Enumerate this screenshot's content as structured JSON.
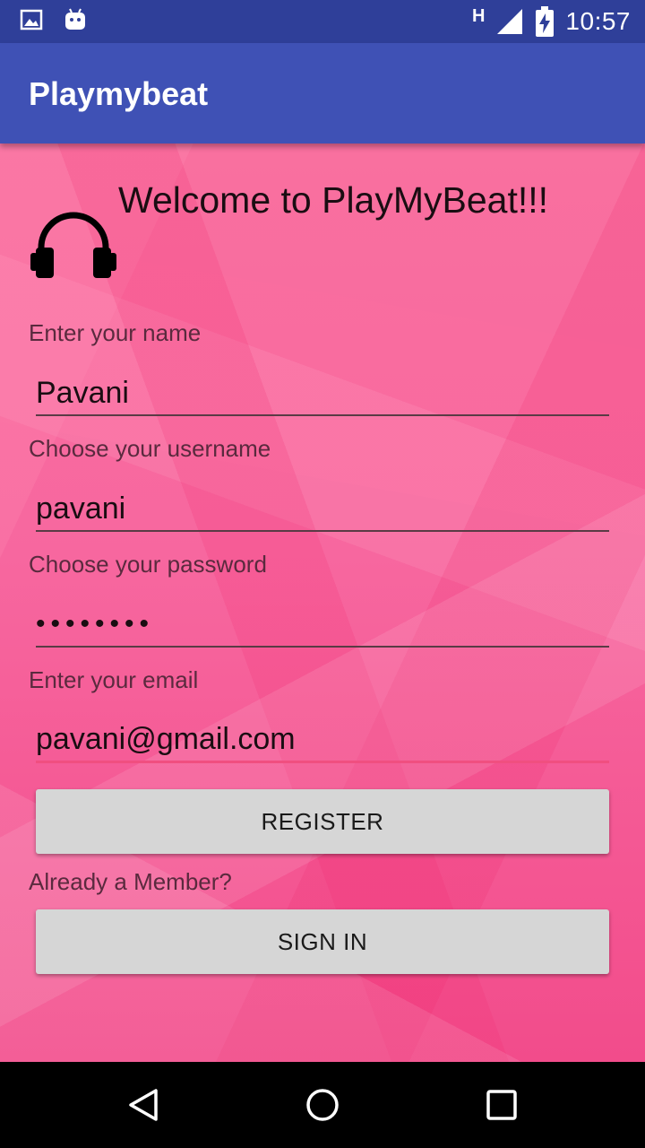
{
  "status_bar": {
    "time": "10:57",
    "network": "H",
    "icons": [
      "image-notification-icon",
      "android-notification-icon",
      "signal-icon",
      "battery-charging-icon"
    ]
  },
  "app_bar": {
    "title": "Playmybeat"
  },
  "main": {
    "welcome": "Welcome to PlayMyBeat!!!",
    "logo_icon": "headphones-icon",
    "fields": {
      "name": {
        "label": "Enter your name",
        "value": "Pavani"
      },
      "username": {
        "label": "Choose your username",
        "value": "pavani"
      },
      "password": {
        "label": "Choose your password",
        "value": "••••••••"
      },
      "email": {
        "label": "Enter your email",
        "value": "pavani@gmail.com"
      }
    },
    "register_label": "REGISTER",
    "member_text": "Already a Member?",
    "signin_label": "SIGN IN"
  },
  "nav_bar": {
    "icons": [
      "back-icon",
      "home-icon",
      "recents-icon"
    ]
  },
  "colors": {
    "status_bar": "#2f3f99",
    "app_bar": "#3f51b5",
    "background": "#f65f9a",
    "button": "#d6d6d6",
    "focus_underline": "#f04f80"
  }
}
